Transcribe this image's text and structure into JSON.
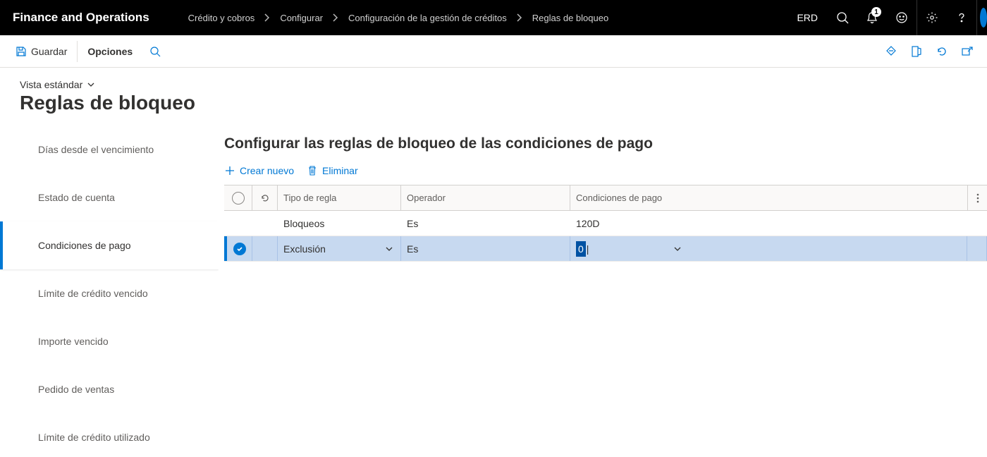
{
  "header": {
    "app_title": "Finance and Operations",
    "breadcrumb": [
      "Crédito y cobros",
      "Configurar",
      "Configuración de la gestión de créditos",
      "Reglas de bloqueo"
    ],
    "company": "ERD",
    "notification_count": "1"
  },
  "action_bar": {
    "save": "Guardar",
    "options": "Opciones"
  },
  "page": {
    "view_label": "Vista estándar",
    "title": "Reglas de bloqueo"
  },
  "sidebar": {
    "items": [
      {
        "label": "Días desde el vencimiento"
      },
      {
        "label": "Estado de cuenta"
      },
      {
        "label": "Condiciones de pago"
      },
      {
        "label": "Límite de crédito vencido"
      },
      {
        "label": "Importe vencido"
      },
      {
        "label": "Pedido de ventas"
      },
      {
        "label": "Límite de crédito utilizado"
      }
    ],
    "active_index": 2
  },
  "main": {
    "title": "Configurar las reglas de bloqueo de las condiciones de pago",
    "toolbar": {
      "new": "Crear nuevo",
      "delete": "Eliminar"
    },
    "columns": {
      "tipo": "Tipo de regla",
      "operador": "Operador",
      "cond": "Condiciones de pago"
    },
    "rows": [
      {
        "selected": false,
        "tipo": "Bloqueos",
        "operador": "Es",
        "cond": "120D"
      },
      {
        "selected": true,
        "tipo": "Exclusión",
        "operador": "Es",
        "cond": "0"
      }
    ]
  }
}
